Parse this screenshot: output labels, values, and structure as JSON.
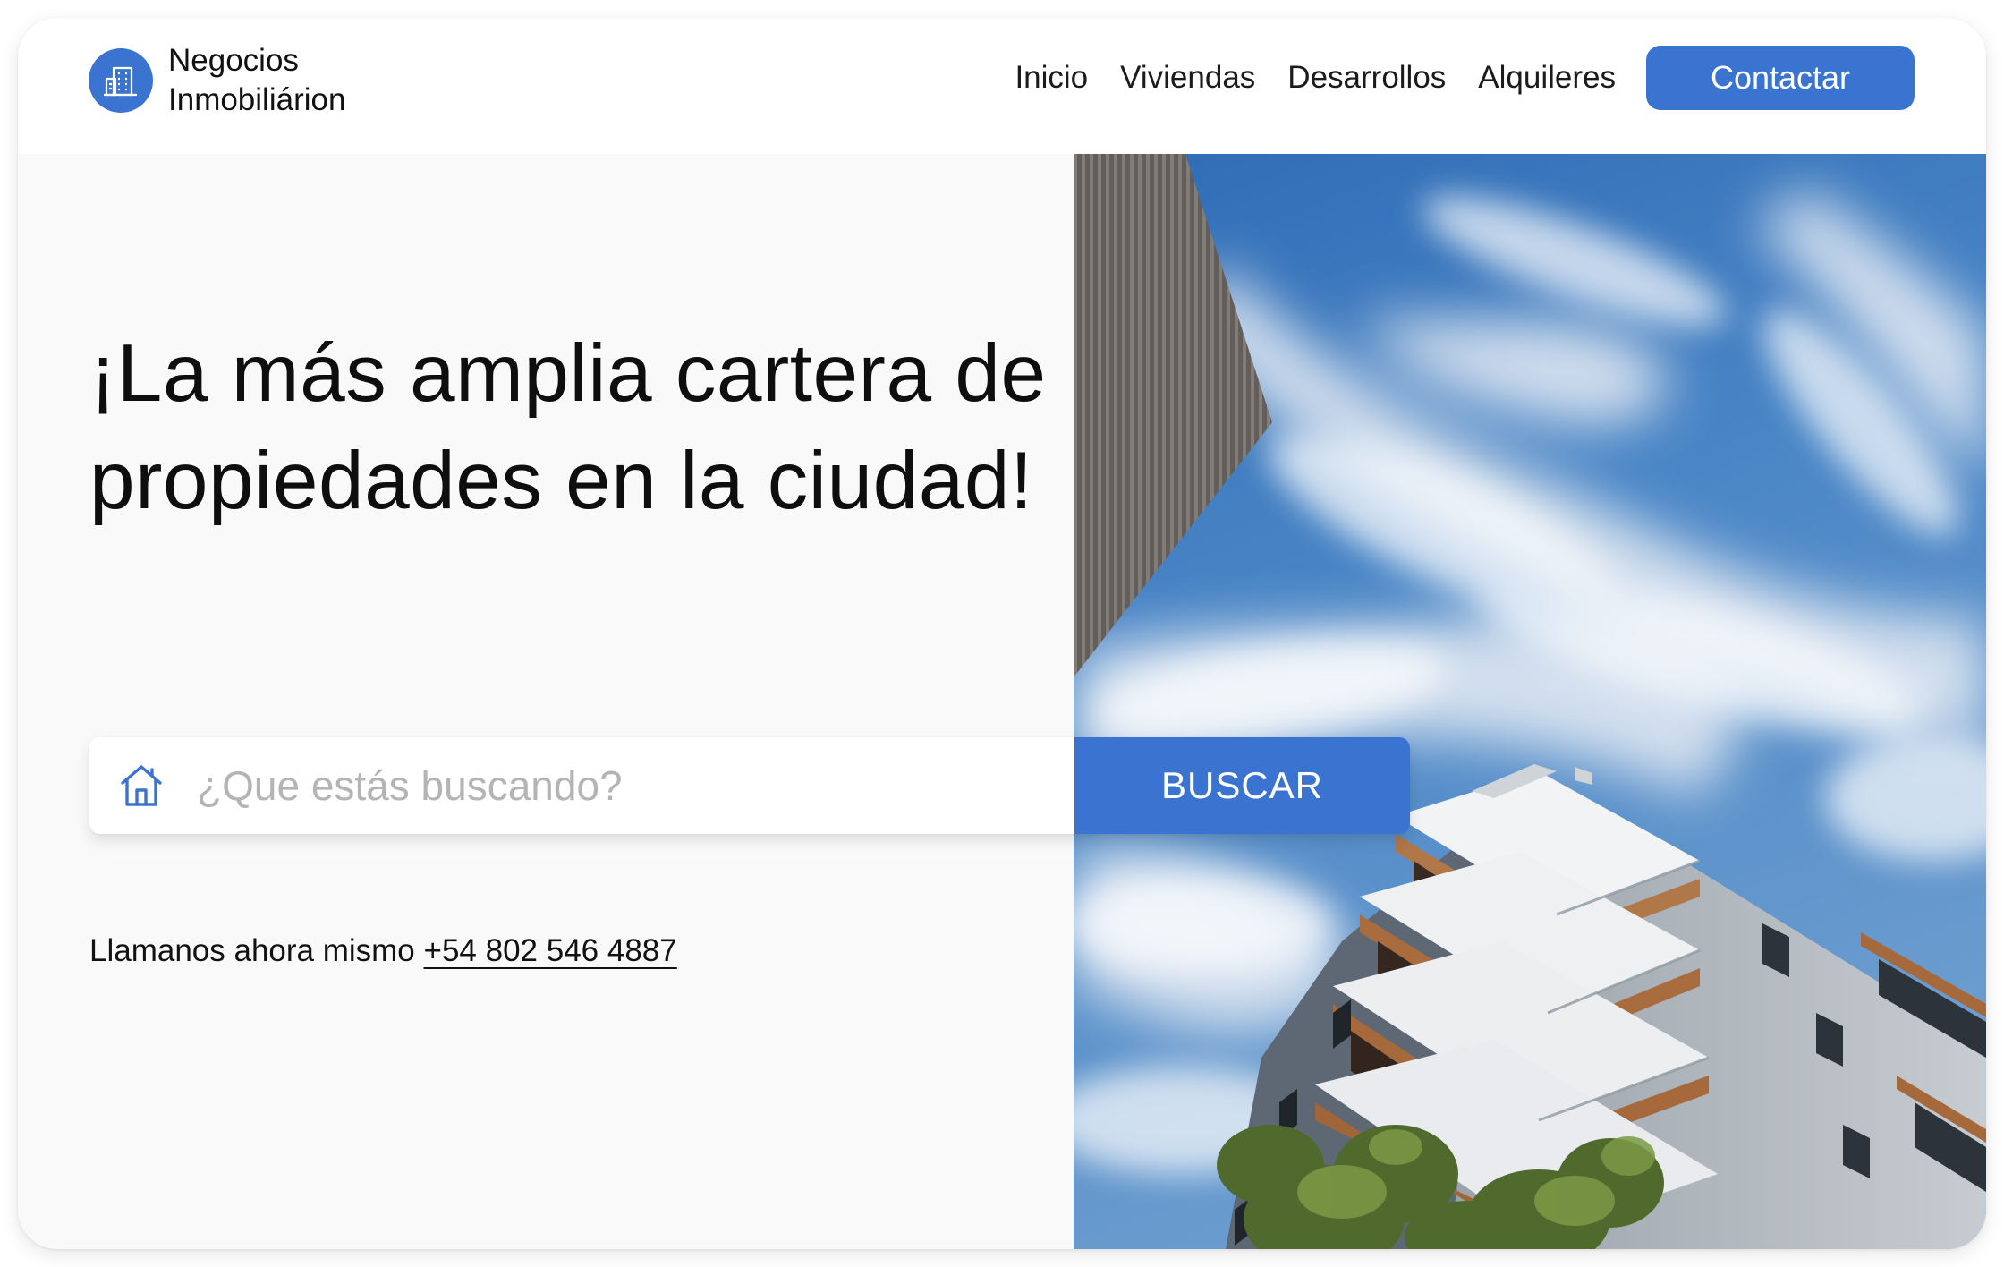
{
  "brand": {
    "name_line1": "Negocios",
    "name_line2": "Inmobiliárion",
    "logo_icon": "building-icon",
    "accent_color": "#3a74d0"
  },
  "nav": {
    "items": [
      "Inicio",
      "Viviendas",
      "Desarrollos",
      "Alquileres"
    ],
    "cta_label": "Contactar"
  },
  "hero": {
    "headline": "¡La más amplia cartera de propiedades en la ciudad!",
    "search": {
      "icon": "house-icon",
      "placeholder": "¿Que estás buscando?",
      "value": "",
      "button_label": "BUSCAR"
    },
    "call": {
      "prefix": "Llamanos ahora mismo",
      "phone": "+54 802 546 4887"
    },
    "image": "building-and-sky-photo"
  }
}
